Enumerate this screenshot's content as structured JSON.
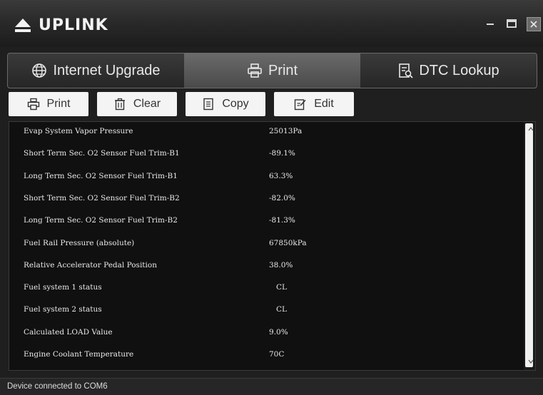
{
  "app": {
    "name": "UPLINK"
  },
  "window_controls": {
    "minimize": "–",
    "maximize": "▭",
    "close": "✕"
  },
  "tabs": [
    {
      "label": "Internet Upgrade",
      "icon": "globe-icon",
      "active": false
    },
    {
      "label": "Print",
      "icon": "printer-icon",
      "active": true
    },
    {
      "label": "DTC Lookup",
      "icon": "search-document-icon",
      "active": false
    }
  ],
  "toolbar": {
    "print_label": "Print",
    "clear_label": "Clear",
    "copy_label": "Copy",
    "edit_label": "Edit"
  },
  "data_rows": [
    {
      "name": "Evap System Vapor Pressure",
      "value": "25013Pa"
    },
    {
      "name": "Short Term Sec. O2 Sensor Fuel Trim-B1",
      "value": "-89.1%"
    },
    {
      "name": "Long Term Sec. O2 Sensor Fuel Trim-B1",
      "value": "63.3%"
    },
    {
      "name": "Short Term Sec. O2 Sensor Fuel Trim-B2",
      "value": "-82.0%"
    },
    {
      "name": "Long Term Sec. O2 Sensor Fuel Trim-B2",
      "value": "-81.3%"
    },
    {
      "name": "Fuel Rail Pressure (absolute)",
      "value": "67850kPa"
    },
    {
      "name": "Relative Accelerator Pedal Position",
      "value": "38.0%"
    },
    {
      "name": "Fuel system 1 status",
      "value": "CL"
    },
    {
      "name": "Fuel system 2 status",
      "value": "CL"
    },
    {
      "name": "Calculated LOAD Value",
      "value": "9.0%"
    },
    {
      "name": "Engine Coolant Temperature",
      "value": "70C"
    }
  ],
  "status": {
    "text": "Device connected to COM6"
  },
  "colors": {
    "background": "#1f1f1f",
    "panel": "#101010",
    "button": "#f4f4f4"
  }
}
